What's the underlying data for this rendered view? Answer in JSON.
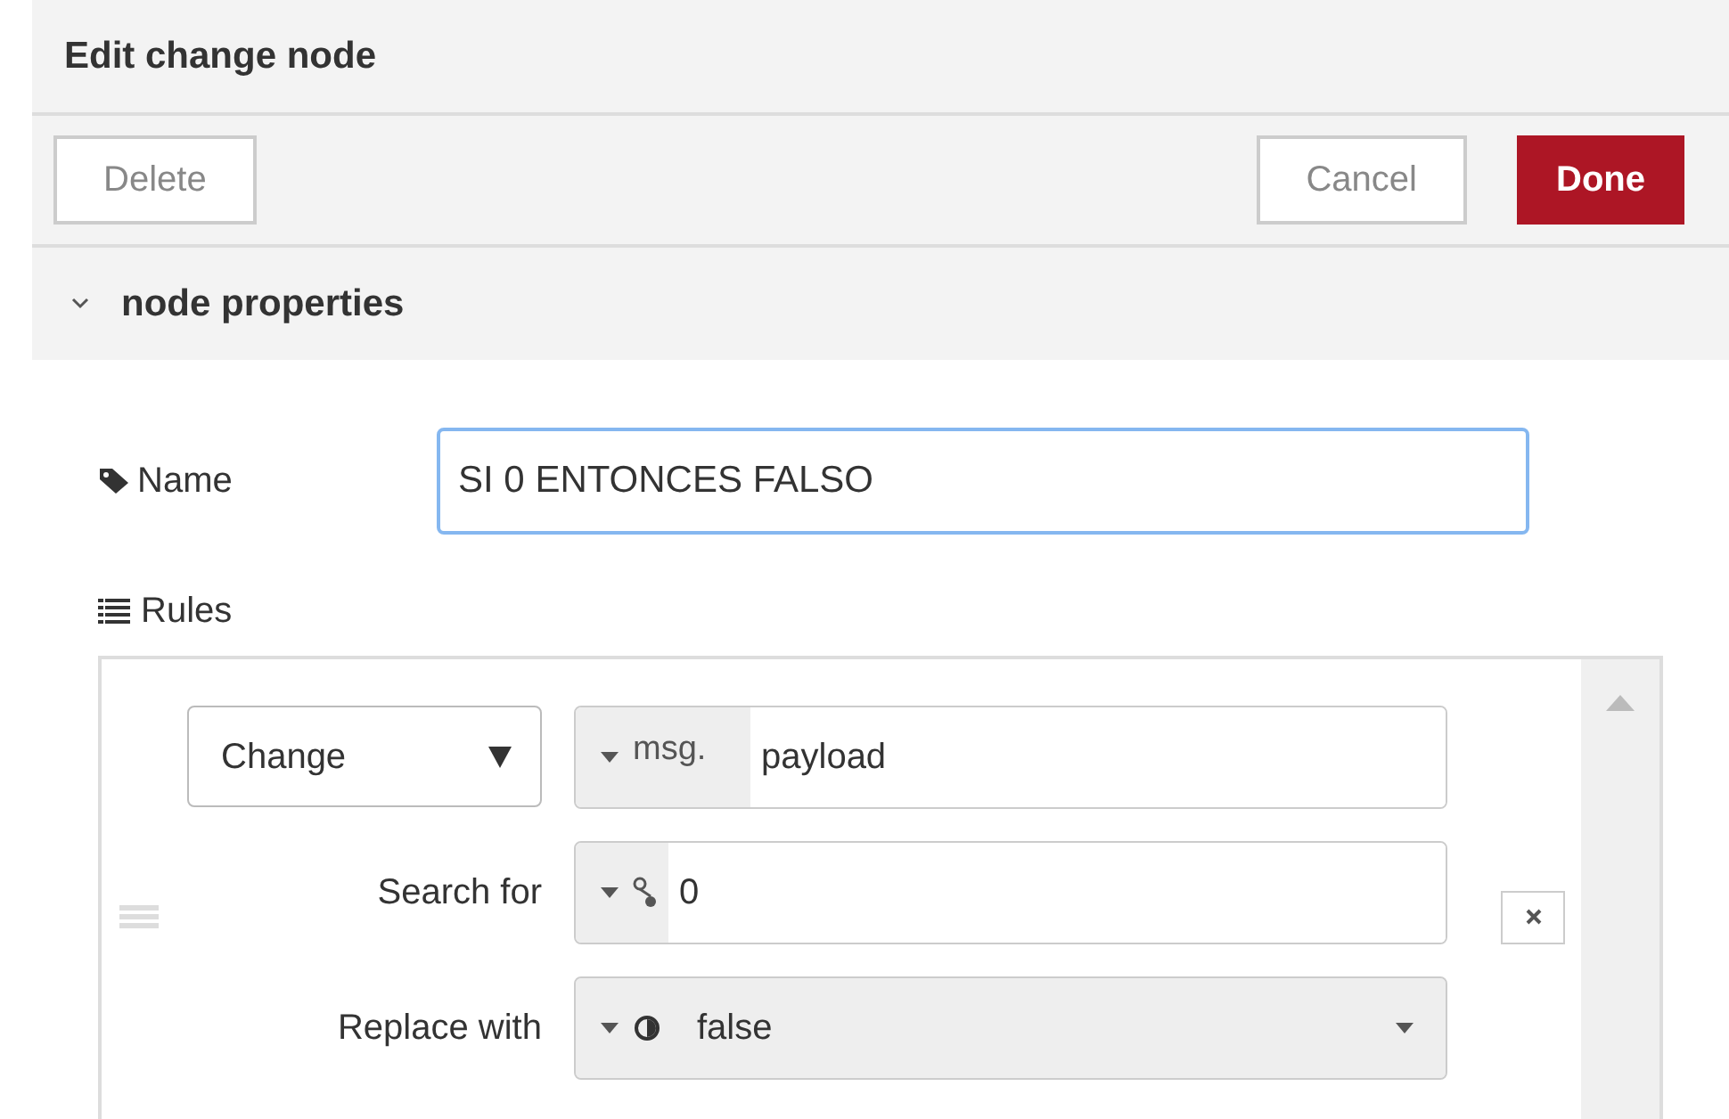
{
  "window": {
    "title": "Edit change node"
  },
  "toolbar": {
    "buttons": [
      {
        "label": "Delete",
        "kind": "plain"
      },
      {
        "label": "Cancel",
        "kind": "plain"
      },
      {
        "label": "Done",
        "kind": "primary"
      }
    ]
  },
  "section": {
    "title": "node properties",
    "expanded": true
  },
  "name_field": {
    "label": "Name",
    "value": "SI 0 ENTONCES FALSO"
  },
  "rules": {
    "label": "Rules",
    "items": [
      {
        "action": "Change",
        "property": {
          "kind": "msg",
          "prefix": "msg.",
          "value": "payload"
        },
        "fields": [
          {
            "label": "Search for",
            "kind": "num",
            "value": "0",
            "dropdown": false
          },
          {
            "label": "Replace with",
            "kind": "bool",
            "value": "false",
            "dropdown": true
          }
        ]
      }
    ]
  }
}
